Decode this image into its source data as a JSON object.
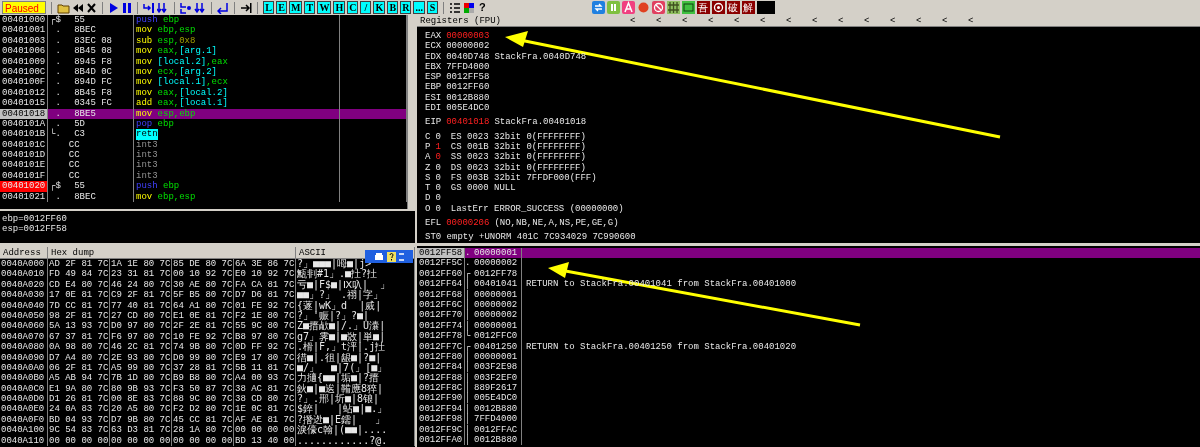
{
  "toolbar": {
    "status": "Paused",
    "letter_buttons": [
      "L",
      "E",
      "M",
      "T",
      "W",
      "H",
      "C",
      "/",
      "K",
      "B",
      "R",
      "...",
      "S"
    ],
    "help": "?",
    "plugin_labels": [
      "吾",
      "破",
      "解"
    ]
  },
  "disassembly": {
    "rows": [
      {
        "address": "00401000",
        "marker": "┌$",
        "bytes": "55",
        "mnemonic": "push",
        "kind": "stack",
        "operands": [
          {
            "text": "ebp",
            "kind": "reg"
          }
        ],
        "selected": false,
        "breakpoint": false
      },
      {
        "address": "00401001",
        "marker": " .",
        "bytes": "8BEC",
        "mnemonic": "mov",
        "kind": "data",
        "operands": [
          {
            "text": "ebp",
            "kind": "reg"
          },
          {
            "text": ",",
            "kind": "sep"
          },
          {
            "text": "esp",
            "kind": "reg"
          }
        ],
        "selected": false,
        "breakpoint": false
      },
      {
        "address": "00401003",
        "marker": " .",
        "bytes": "83EC 08",
        "mnemonic": "sub",
        "kind": "data",
        "operands": [
          {
            "text": "esp",
            "kind": "reg"
          },
          {
            "text": ",",
            "kind": "sep"
          },
          {
            "text": "0x8",
            "kind": "imm"
          }
        ],
        "selected": false,
        "breakpoint": false
      },
      {
        "address": "00401006",
        "marker": " .",
        "bytes": "8B45 08",
        "mnemonic": "mov",
        "kind": "data",
        "operands": [
          {
            "text": "eax",
            "kind": "reg"
          },
          {
            "text": ",",
            "kind": "sep"
          },
          {
            "text": "[arg.1]",
            "kind": "mem"
          }
        ],
        "selected": false,
        "breakpoint": false
      },
      {
        "address": "00401009",
        "marker": " .",
        "bytes": "8945 F8",
        "mnemonic": "mov",
        "kind": "data",
        "operands": [
          {
            "text": "[local.2]",
            "kind": "mem"
          },
          {
            "text": ",",
            "kind": "sep"
          },
          {
            "text": "eax",
            "kind": "reg"
          }
        ],
        "selected": false,
        "breakpoint": false
      },
      {
        "address": "0040100C",
        "marker": " .",
        "bytes": "8B4D 0C",
        "mnemonic": "mov",
        "kind": "data",
        "operands": [
          {
            "text": "ecx",
            "kind": "reg"
          },
          {
            "text": ",",
            "kind": "sep"
          },
          {
            "text": "[arg.2]",
            "kind": "mem"
          }
        ],
        "selected": false,
        "breakpoint": false
      },
      {
        "address": "0040100F",
        "marker": " .",
        "bytes": "894D FC",
        "mnemonic": "mov",
        "kind": "data",
        "operands": [
          {
            "text": "[local.1]",
            "kind": "mem"
          },
          {
            "text": ",",
            "kind": "sep"
          },
          {
            "text": "ecx",
            "kind": "reg"
          }
        ],
        "selected": false,
        "breakpoint": false
      },
      {
        "address": "00401012",
        "marker": " .",
        "bytes": "8B45 F8",
        "mnemonic": "mov",
        "kind": "data",
        "operands": [
          {
            "text": "eax",
            "kind": "reg"
          },
          {
            "text": ",",
            "kind": "sep"
          },
          {
            "text": "[local.2]",
            "kind": "mem"
          }
        ],
        "selected": false,
        "breakpoint": false
      },
      {
        "address": "00401015",
        "marker": " .",
        "bytes": "0345 FC",
        "mnemonic": "add",
        "kind": "data",
        "operands": [
          {
            "text": "eax",
            "kind": "reg"
          },
          {
            "text": ",",
            "kind": "sep"
          },
          {
            "text": "[local.1]",
            "kind": "mem"
          }
        ],
        "selected": false,
        "breakpoint": false
      },
      {
        "address": "00401018",
        "marker": " .",
        "bytes": "8BE5",
        "mnemonic": "mov",
        "kind": "data",
        "operands": [
          {
            "text": "esp",
            "kind": "reg"
          },
          {
            "text": ",",
            "kind": "sep"
          },
          {
            "text": "ebp",
            "kind": "reg"
          }
        ],
        "selected": true,
        "breakpoint": false
      },
      {
        "address": "0040101A",
        "marker": " .",
        "bytes": "5D",
        "mnemonic": "pop",
        "kind": "stack",
        "operands": [
          {
            "text": "ebp",
            "kind": "reg"
          }
        ],
        "selected": false,
        "breakpoint": false
      },
      {
        "address": "0040101B",
        "marker": "└.",
        "bytes": "C3",
        "mnemonic": "retn",
        "kind": "ret",
        "operands": [],
        "selected": false,
        "breakpoint": false
      },
      {
        "address": "0040101C",
        "marker": "",
        "bytes": "CC",
        "mnemonic": "int3",
        "kind": "int",
        "operands": [],
        "selected": false,
        "breakpoint": false
      },
      {
        "address": "0040101D",
        "marker": "",
        "bytes": "CC",
        "mnemonic": "int3",
        "kind": "int",
        "operands": [],
        "selected": false,
        "breakpoint": false
      },
      {
        "address": "0040101E",
        "marker": "",
        "bytes": "CC",
        "mnemonic": "int3",
        "kind": "int",
        "operands": [],
        "selected": false,
        "breakpoint": false
      },
      {
        "address": "0040101F",
        "marker": "",
        "bytes": "CC",
        "mnemonic": "int3",
        "kind": "int",
        "operands": [],
        "selected": false,
        "breakpoint": false
      },
      {
        "address": "00401020",
        "marker": "┌$",
        "bytes": "55",
        "mnemonic": "push",
        "kind": "stack",
        "operands": [
          {
            "text": "ebp",
            "kind": "reg"
          }
        ],
        "selected": false,
        "breakpoint": true
      },
      {
        "address": "00401021",
        "marker": " .",
        "bytes": "8BEC",
        "mnemonic": "mov",
        "kind": "data",
        "operands": [
          {
            "text": "ebp",
            "kind": "reg"
          },
          {
            "text": ",",
            "kind": "sep"
          },
          {
            "text": "esp",
            "kind": "reg"
          }
        ],
        "selected": false,
        "breakpoint": false
      }
    ]
  },
  "info": [
    "ebp=0012FF60",
    "esp=0012FF58"
  ],
  "dump": {
    "columns": [
      "Address",
      "Hex dump",
      "ASCII"
    ],
    "rows": [
      {
        "address": "0040A000",
        "hex": [
          "AD 2F 81 7C",
          "1A 1E 80 7C",
          "85 DE 80 7C",
          "6A 3E 86 7C"
        ],
        "ascii": "?」■■■|呣■|j>"
      },
      {
        "address": "0040A010",
        "hex": [
          "FD 49 84 7C",
          "23 31 81 7C",
          "00 10 92 7C",
          "E0 10 92 7C"
        ],
        "ascii": "甒剕#1」.■扗?扗"
      },
      {
        "address": "0040A020",
        "hex": [
          "CD E4 80 7C",
          "46 24 80 7C",
          "30 AE 80 7C",
          "FA CA 81 7C"
        ],
        "ascii": "亏■|F$■|Ⅸ叺|  」"
      },
      {
        "address": "0040A030",
        "hex": [
          "17 0E 81 7C",
          "C9 2F 81 7C",
          "5F B5 80 7C",
          "D7 D6 81 7C"
        ],
        "ascii": "■■」?」 .祤|字」"
      },
      {
        "address": "0040A040",
        "hex": [
          "7D CC 81 7C",
          "77 40 81 7C",
          "64 A1 80 7C",
          "01 FE 92 7C"
        ],
        "ascii": "{蓫|wK」d  |烕|"
      },
      {
        "address": "0040A050",
        "hex": [
          "98 2F 81 7C",
          "27 CD 80 7C",
          "E1 0E 81 7C",
          "F2 1E 80 7C"
        ],
        "ascii": "?」'赈|?」?■|"
      },
      {
        "address": "0040A060",
        "hex": [
          "5A 13 93 7C",
          "D0 97 80 7C",
          "2F 2E 81 7C",
          "55 9C 80 7C"
        ],
        "ascii": "Z■搢欳■|/.」U灢|"
      },
      {
        "address": "0040A070",
        "hex": [
          "67 37 81 7C",
          "F6 97 80 7C",
          "10 FE 92 7C",
          "B8 97 80 7C"
        ],
        "ascii": "g7」霁■|■敚|単■|"
      },
      {
        "address": "0040A080",
        "hex": [
          "0A 98 80 7C",
          "46 2C 81 7C",
          "74 9B 80 7C",
          "0D FF 92 7C"
        ],
        "ascii": ".榾|F,」t泙|.j扗"
      },
      {
        "address": "0040A090",
        "hex": [
          "D7 A4 80 7C",
          "2E 93 80 7C",
          "D0 99 80 7C",
          "E9 17 80 7C"
        ],
        "ascii": "徣■|.徂|龈■|?■|"
      },
      {
        "address": "0040A0A0",
        "hex": [
          "06 2F 81 7C",
          "A5 99 80 7C",
          "37 28 81 7C",
          "5B 11 81 7C"
        ],
        "ascii": "■/」  ■|7(」[■」"
      },
      {
        "address": "0040A0B0",
        "hex": [
          "A5 AB 94 7C",
          "7B 1D 80 7C",
          "B9 B8 80 7C",
          "A4 00 93 7C"
        ],
        "ascii": "力擿{■■|垢■|?搢"
      },
      {
        "address": "0040A0C0",
        "hex": [
          "E1 9A 80 7C",
          "80 9B 93 7C",
          "F3 50 87 7C",
          "38 AC 81 7C"
        ],
        "ascii": "鈥■|■逘|鞴應8猝|"
      },
      {
        "address": "0040A0D0",
        "hex": [
          "D1 26 81 7C",
          "00 8E 83 7C",
          "88 9C 80 7C",
          "38 CD 80 7C"
        ],
        "ascii": "?」.郉|圻■|8锒|"
      },
      {
        "address": "0040A0E0",
        "hex": [
          "24 0A 83 7C",
          "20 A5 80 7C",
          "F2 D2 80 7C",
          "1E 0C 81 7C"
        ],
        "ascii": "$錊|   |蛅■|■.」"
      },
      {
        "address": "0040A0F0",
        "hex": [
          "BD 04 93 7C",
          "D7 9B 80 7C",
          "45 CC 81 7C",
          "AF AE 81 7C"
        ],
        "ascii": "?撍迯■|E鑐|   」"
      },
      {
        "address": "0040A100",
        "hex": [
          "9C 54 83 7C",
          "63 D3 81 7C",
          "28 1A 80 7C",
          "00 00 00 00"
        ],
        "ascii": "淚儫c翰|(■■|...."
      },
      {
        "address": "0040A110",
        "hex": [
          "00 00 00 00",
          "00 00 00 00",
          "00 00 00 00",
          "BD 13 40 00"
        ],
        "ascii": "............?@."
      }
    ]
  },
  "registers": {
    "title": "Registers (FPU)",
    "header_marks": [
      "<",
      "<",
      "<",
      "<",
      "<",
      "<",
      "<",
      "<",
      "<",
      "<",
      "<",
      "<",
      "<",
      "<"
    ],
    "general": [
      {
        "name": "EAX",
        "value": "00000003",
        "changed": true
      },
      {
        "name": "ECX",
        "value": "00000002",
        "changed": false
      },
      {
        "name": "EDX",
        "value": "0040D748",
        "changed": false,
        "comment": "StackFra.0040D748"
      },
      {
        "name": "EBX",
        "value": "7FFD4000",
        "changed": false
      },
      {
        "name": "ESP",
        "value": "0012FF58",
        "changed": false
      },
      {
        "name": "EBP",
        "value": "0012FF60",
        "changed": false
      },
      {
        "name": "ESI",
        "value": "0012B880",
        "changed": false
      },
      {
        "name": "EDI",
        "value": "005E4DC0",
        "changed": false
      }
    ],
    "eip": {
      "name": "EIP",
      "value": "00401018",
      "changed": true,
      "comment": "StackFra.00401018"
    },
    "flags": [
      {
        "name": "C",
        "value": "0",
        "changed": false,
        "detail": "ES 0023 32bit 0(FFFFFFFF)"
      },
      {
        "name": "P",
        "value": "1",
        "changed": true,
        "detail": "CS 001B 32bit 0(FFFFFFFF)"
      },
      {
        "name": "A",
        "value": "0",
        "changed": true,
        "detail": "SS 0023 32bit 0(FFFFFFFF)"
      },
      {
        "name": "Z",
        "value": "0",
        "changed": false,
        "detail": "DS 0023 32bit 0(FFFFFFFF)"
      },
      {
        "name": "S",
        "value": "0",
        "changed": false,
        "detail": "FS 003B 32bit 7FFDF000(FFF)"
      },
      {
        "name": "T",
        "value": "0",
        "changed": false,
        "detail": "GS 0000 NULL"
      },
      {
        "name": "D",
        "value": "0",
        "changed": false
      },
      {
        "name": "O",
        "value": "0",
        "changed": false,
        "detail": "LastErr ERROR_SUCCESS (00000000)"
      }
    ],
    "efl": {
      "name": "EFL",
      "value": "00000206",
      "changed": true,
      "comment": "(NO,NB,NE,A,NS,PE,GE,G)"
    },
    "st0": "ST0 empty +UNORM 401C 7C934029 7C990600"
  },
  "stack": {
    "rows": [
      {
        "address": "0012FF58",
        "marker": ".",
        "value": "00000001",
        "selected": true
      },
      {
        "address": "0012FF5C",
        "marker": ".",
        "value": "00000002",
        "selected": false
      },
      {
        "address": "0012FF60",
        "marker": "┌",
        "value": "0012FF78",
        "selected": false
      },
      {
        "address": "0012FF64",
        "marker": "│",
        "value": "00401041",
        "comment": "RETURN to StackFra.00401041 from StackFra.00401000",
        "selected": false
      },
      {
        "address": "0012FF68",
        "marker": "│",
        "value": "00000001",
        "selected": false
      },
      {
        "address": "0012FF6C",
        "marker": "│",
        "value": "00000002",
        "selected": false
      },
      {
        "address": "0012FF70",
        "marker": "│",
        "value": "00000002",
        "selected": false
      },
      {
        "address": "0012FF74",
        "marker": "│",
        "value": "00000001",
        "selected": false
      },
      {
        "address": "0012FF78",
        "marker": "└",
        "value": "0012FFC0",
        "selected": false
      },
      {
        "address": "0012FF7C",
        "marker": "┌",
        "value": "00401250",
        "comment": "RETURN to StackFra.00401250 from StackFra.00401020",
        "selected": false
      },
      {
        "address": "0012FF80",
        "marker": "│",
        "value": "00000001",
        "selected": false
      },
      {
        "address": "0012FF84",
        "marker": "│",
        "value": "003F2E98",
        "selected": false
      },
      {
        "address": "0012FF88",
        "marker": "│",
        "value": "003F2EF0",
        "selected": false
      },
      {
        "address": "0012FF8C",
        "marker": "│",
        "value": "889F2617",
        "selected": false
      },
      {
        "address": "0012FF90",
        "marker": "│",
        "value": "005E4DC0",
        "selected": false
      },
      {
        "address": "0012FF94",
        "marker": "│",
        "value": "0012B880",
        "selected": false
      },
      {
        "address": "0012FF98",
        "marker": "│",
        "value": "7FFD4000",
        "selected": false
      },
      {
        "address": "0012FF9C",
        "marker": "│",
        "value": "0012FFAC",
        "selected": false
      },
      {
        "address": "0012FFA0",
        "marker": "│",
        "value": "0012B880",
        "selected": false
      }
    ]
  }
}
